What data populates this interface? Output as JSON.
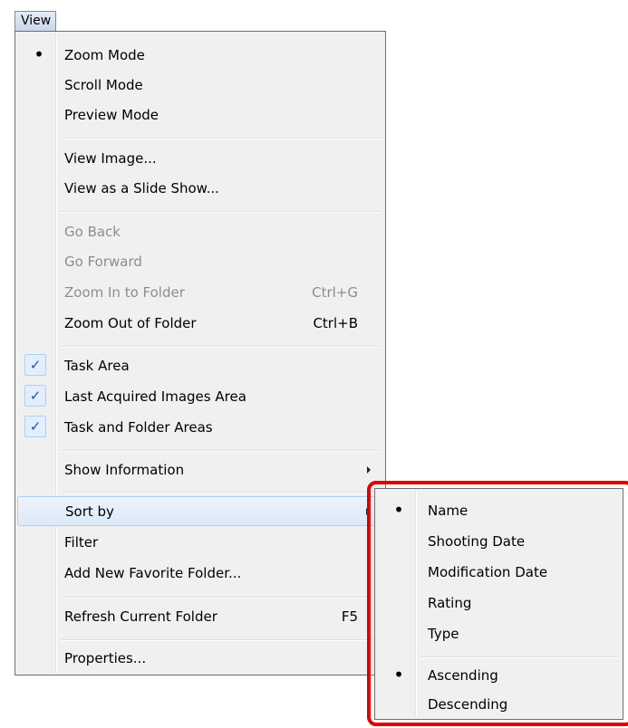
{
  "menubar": {
    "view_label": "View"
  },
  "main_menu": {
    "zoom_mode": "Zoom Mode",
    "scroll_mode": "Scroll Mode",
    "preview_mode": "Preview Mode",
    "view_image": "View Image...",
    "view_slide_show": "View as a Slide Show...",
    "go_back": "Go Back",
    "go_forward": "Go Forward",
    "zoom_in_folder": "Zoom In to Folder",
    "zoom_in_shortcut": "Ctrl+G",
    "zoom_out_folder": "Zoom Out of Folder",
    "zoom_out_shortcut": "Ctrl+B",
    "task_area": "Task Area",
    "last_acquired": "Last Acquired Images Area",
    "task_folder_areas": "Task and Folder Areas",
    "show_information": "Show Information",
    "sort_by": "Sort by",
    "filter": "Filter",
    "add_favorite": "Add New Favorite Folder...",
    "refresh_folder": "Refresh Current Folder",
    "refresh_shortcut": "F5",
    "properties": "Properties..."
  },
  "sort_submenu": {
    "name": "Name",
    "shooting_date": "Shooting Date",
    "modification_date": "Modification Date",
    "rating": "Rating",
    "type": "Type",
    "ascending": "Ascending",
    "descending": "Descending"
  },
  "glyphs": {
    "bullet": "•",
    "check": "✓"
  },
  "colors": {
    "highlight_border": "#e00000",
    "check_color": "#1f4fa8",
    "hover_bg": "#dce9f8"
  }
}
